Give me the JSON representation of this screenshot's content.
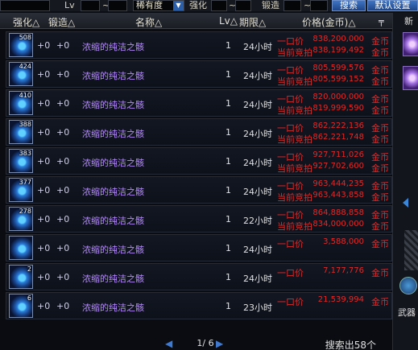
{
  "topbar": {
    "lv_label": "Lv",
    "range_sep": "~",
    "rarity_value": "稀有度",
    "enhance_label": "强化",
    "forge_label": "锻造",
    "search_button": "搜索",
    "default_button": "默认设置"
  },
  "columns": {
    "enhance": "强化△",
    "forge": "锻造△",
    "name": "名称△",
    "lv": "Lv△",
    "duration": "期限△",
    "price": "价格(金币)△"
  },
  "price_labels": {
    "buyout": "一口价",
    "current_bid": "当前竞拍",
    "currency": "金币"
  },
  "rows": [
    {
      "count": "508",
      "enhance": "+0",
      "forge": "+0",
      "name": "浓缩的纯洁之骸",
      "lv": "1",
      "time": "24小时",
      "buyout": "838,200,000",
      "bid": "838,199,492"
    },
    {
      "count": "424",
      "enhance": "+0",
      "forge": "+0",
      "name": "浓缩的纯洁之骸",
      "lv": "1",
      "time": "24小时",
      "buyout": "805,599,576",
      "bid": "805,599,152"
    },
    {
      "count": "410",
      "enhance": "+0",
      "forge": "+0",
      "name": "浓缩的纯洁之骸",
      "lv": "1",
      "time": "24小时",
      "buyout": "820,000,000",
      "bid": "819,999,590"
    },
    {
      "count": "388",
      "enhance": "+0",
      "forge": "+0",
      "name": "浓缩的纯洁之骸",
      "lv": "1",
      "time": "24小时",
      "buyout": "862,222,136",
      "bid": "862,221,748"
    },
    {
      "count": "383",
      "enhance": "+0",
      "forge": "+0",
      "name": "浓缩的纯洁之骸",
      "lv": "1",
      "time": "24小时",
      "buyout": "927,711,026",
      "bid": "927,702,600"
    },
    {
      "count": "377",
      "enhance": "+0",
      "forge": "+0",
      "name": "浓缩的纯洁之骸",
      "lv": "1",
      "time": "24小时",
      "buyout": "963,444,235",
      "bid": "963,443,858"
    },
    {
      "count": "278",
      "enhance": "+0",
      "forge": "+0",
      "name": "浓缩的纯洁之骸",
      "lv": "1",
      "time": "22小时",
      "buyout": "864,888,858",
      "bid": "834,000,000"
    },
    {
      "count": "",
      "enhance": "+0",
      "forge": "+0",
      "name": "浓缩的纯洁之骸",
      "lv": "1",
      "time": "24小时",
      "buyout": "3,588,000",
      "bid": null
    },
    {
      "count": "2",
      "enhance": "+0",
      "forge": "+0",
      "name": "浓缩的纯洁之骸",
      "lv": "1",
      "time": "24小时",
      "buyout": "7,177,776",
      "bid": null
    },
    {
      "count": "6",
      "enhance": "+0",
      "forge": "+0",
      "name": "浓缩的纯洁之骸",
      "lv": "1",
      "time": "23小时",
      "buyout": "21,539,994",
      "bid": null
    }
  ],
  "pager": {
    "page": "1/ 6"
  },
  "result_count": "搜索出58个",
  "side": {
    "top_label": "新",
    "category_label": "武器"
  },
  "colors": {
    "price_red": "#e02a2a",
    "name_purple": "#b78cff",
    "accent_blue": "#2b5ea8"
  }
}
